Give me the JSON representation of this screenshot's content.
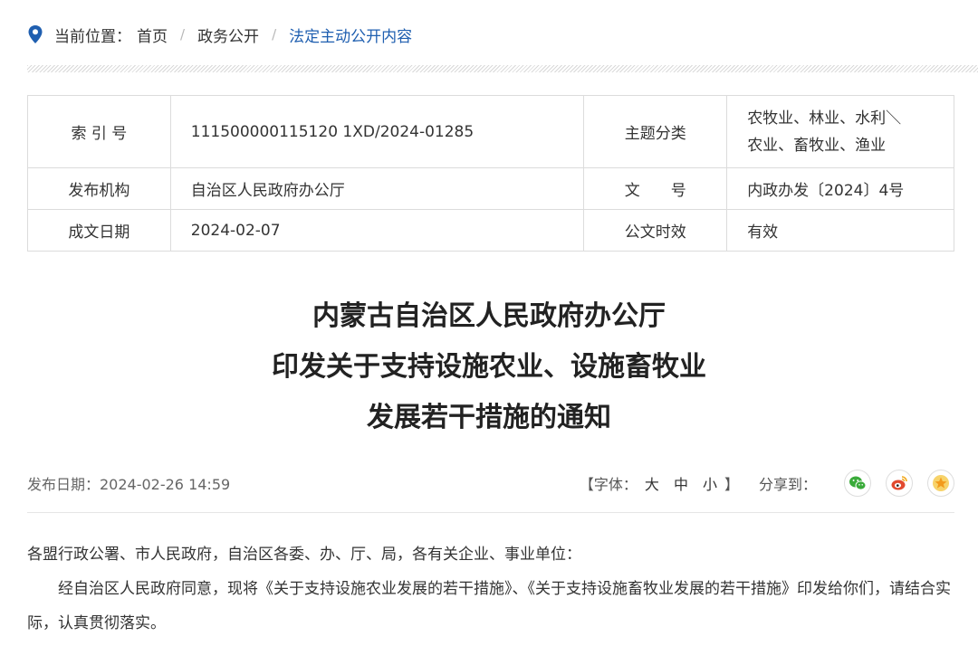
{
  "breadcrumb": {
    "label": "当前位置：",
    "items": [
      "首页",
      "政务公开",
      "法定主动公开内容"
    ]
  },
  "meta": {
    "index_label": "索 引 号",
    "index_value": "111500000115120 1XD/2024-01285",
    "topic_label": "主题分类",
    "topic_line1": "农牧业、林业、水利＼",
    "topic_line2": "农业、畜牧业、渔业",
    "issuer_label": "发布机构",
    "issuer_value": "自治区人民政府办公厅",
    "docno_label": "文　　号",
    "docno_value": "内政办发〔2024〕4号",
    "date_label": "成文日期",
    "date_value": "2024-02-07",
    "validity_label": "公文时效",
    "validity_value": "有效"
  },
  "article": {
    "title_line1": "内蒙古自治区人民政府办公厅",
    "title_line2": "印发关于支持设施农业、设施畜牧业",
    "title_line3": "发展若干措施的通知",
    "publish_date": "发布日期：2024-02-26 14:59",
    "font_prefix": "【字体：",
    "font_large": "大",
    "font_medium": "中",
    "font_small": "小",
    "font_suffix": "】",
    "share_label": "分享到：",
    "para1": "各盟行政公署、市人民政府，自治区各委、办、厅、局，各有关企业、事业单位：",
    "para2": "经自治区人民政府同意，现将《关于支持设施农业发展的若干措施》、《关于支持设施畜牧业发展的若干措施》印发给你们，请结合实际，认真贯彻落实。"
  },
  "colors": {
    "link": "#1f5fb0",
    "wechat": "#3aab3a",
    "weibo": "#e24a2f",
    "favorite": "#f2a81c"
  },
  "icons": [
    "location-pin-icon",
    "wechat-icon",
    "weibo-icon",
    "star-icon"
  ]
}
